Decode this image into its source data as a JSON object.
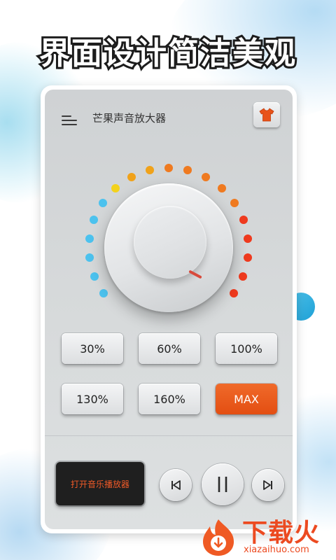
{
  "promo": {
    "headline": "界面设计简洁美观"
  },
  "app": {
    "title": "芒果声音放大器",
    "menu_icon": "menu-icon",
    "skin_icon": "tshirt-icon",
    "accent_color": "#e8531a"
  },
  "knob": {
    "pointer_color": "#d84a3c",
    "dot_colors": [
      "#4cc2ee",
      "#f3d21c",
      "#f0a21a",
      "#ef7a20",
      "#ef3a1e"
    ]
  },
  "presets": [
    {
      "label": "30%",
      "active": false
    },
    {
      "label": "60%",
      "active": false
    },
    {
      "label": "100%",
      "active": false
    },
    {
      "label": "130%",
      "active": false
    },
    {
      "label": "160%",
      "active": false
    },
    {
      "label": "MAX",
      "active": true
    }
  ],
  "player": {
    "open_label": "打开音乐播放器",
    "prev_icon": "skip-previous-icon",
    "pause_icon": "pause-icon",
    "next_icon": "skip-next-icon"
  },
  "brand": {
    "name": "下载火",
    "url": "xiazaihuo.com"
  }
}
